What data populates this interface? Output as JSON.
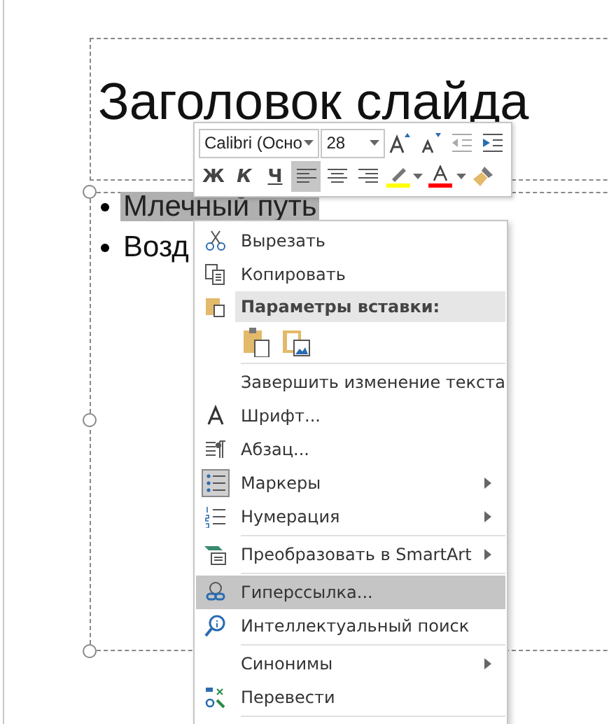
{
  "slide": {
    "title": "Заголовок слайда",
    "bullets": [
      {
        "text": "Млечный путь",
        "selected": true
      },
      {
        "text": "Возд",
        "selected": false
      }
    ]
  },
  "mini_toolbar": {
    "font": "Calibri (Осно",
    "size": "28",
    "format_buttons": [
      "Ж",
      "К",
      "Ч"
    ],
    "alignments": [
      {
        "selected": true
      },
      {
        "selected": false
      },
      {
        "selected": false
      }
    ]
  },
  "context_menu": [
    {
      "kind": "item",
      "label": "Вырезать",
      "highlighted": false,
      "submenu": false,
      "checked": false
    },
    {
      "kind": "item",
      "label": "Копировать",
      "highlighted": false,
      "submenu": false,
      "checked": false
    },
    {
      "kind": "header",
      "label": "Параметры вставки:"
    },
    {
      "kind": "paste"
    },
    {
      "kind": "separator"
    },
    {
      "kind": "item",
      "label": "Завершить изменение текста",
      "highlighted": false,
      "submenu": false,
      "checked": false
    },
    {
      "kind": "item",
      "label": "Шрифт...",
      "highlighted": false,
      "submenu": false,
      "checked": false
    },
    {
      "kind": "item",
      "label": "Абзац...",
      "highlighted": false,
      "submenu": false,
      "checked": false
    },
    {
      "kind": "item",
      "label": "Маркеры",
      "highlighted": false,
      "submenu": true,
      "checked": true
    },
    {
      "kind": "item",
      "label": "Нумерация",
      "highlighted": false,
      "submenu": true,
      "checked": false
    },
    {
      "kind": "separator"
    },
    {
      "kind": "item",
      "label": "Преобразовать в SmartArt",
      "highlighted": false,
      "submenu": true,
      "checked": false
    },
    {
      "kind": "separator"
    },
    {
      "kind": "item",
      "label": "Гиперссылка...",
      "highlighted": true,
      "submenu": false,
      "checked": false
    },
    {
      "kind": "item",
      "label": "Интеллектуальный поиск",
      "highlighted": false,
      "submenu": false,
      "checked": false
    },
    {
      "kind": "separator"
    },
    {
      "kind": "item",
      "label": "Синонимы",
      "highlighted": false,
      "submenu": true,
      "checked": false
    },
    {
      "kind": "item",
      "label": "Перевести",
      "highlighted": false,
      "submenu": false,
      "checked": false
    },
    {
      "kind": "separator"
    }
  ]
}
